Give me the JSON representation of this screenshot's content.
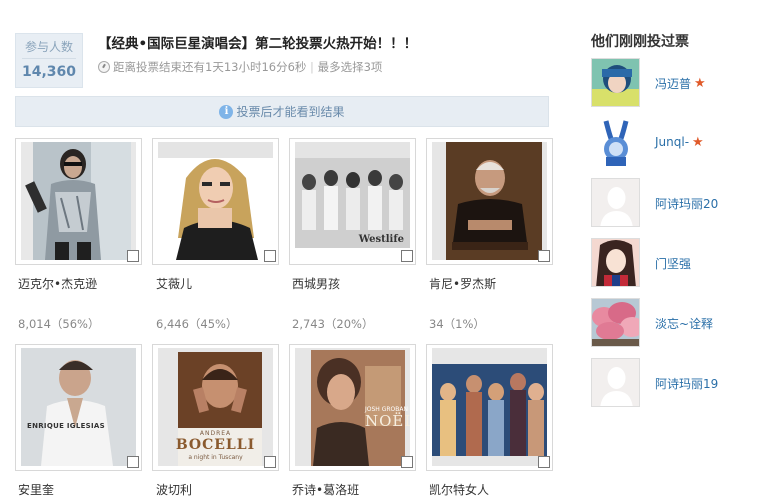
{
  "participants": {
    "label": "参与人数",
    "count": "14,360"
  },
  "poll": {
    "title": "【经典•国际巨星演唱会】第二轮投票火热开始！！！",
    "countdown": "距离投票结束还有1天13小时16分6秒",
    "separator": " | ",
    "max_choice": "最多选择3项"
  },
  "notice": {
    "text": "投票后才能看到结果"
  },
  "candidates": [
    {
      "name": "迈克尔•杰克逊",
      "votes": "8,014（56%）"
    },
    {
      "name": "艾薇儿",
      "votes": "6,446（45%）"
    },
    {
      "name": "西城男孩",
      "votes": "2,743（20%）"
    },
    {
      "name": "肯尼•罗杰斯",
      "votes": "34（1%）"
    },
    {
      "name": "安里奎"
    },
    {
      "name": "波切利"
    },
    {
      "name": "乔诗•葛洛班"
    },
    {
      "name": "凯尔特女人"
    }
  ],
  "photo_texts": {
    "westlife": "Westlife",
    "enrique": "ENRIQUE IGLESIAS",
    "bocelli_top": "ANDREA",
    "bocelli": "BOCELLI",
    "bocelli_sub": "a night in Tuscany",
    "groban": "JOSH GROBAN",
    "groban_noel": "NOËL"
  },
  "sidebar": {
    "title": "他们刚刚投过票",
    "users": [
      {
        "name": "冯迈普",
        "badge": "star-icon"
      },
      {
        "name": "Junql-",
        "badge": "star-icon"
      },
      {
        "name": "阿诗玛丽20"
      },
      {
        "name": "门坚强"
      },
      {
        "name": "淡忘~诠释"
      },
      {
        "name": "阿诗玛丽19"
      }
    ]
  },
  "colors": {
    "accent": "#5f87ad",
    "link": "#2a6fa8",
    "notice_bg": "#e7edf3",
    "star": "#e05a2a"
  }
}
